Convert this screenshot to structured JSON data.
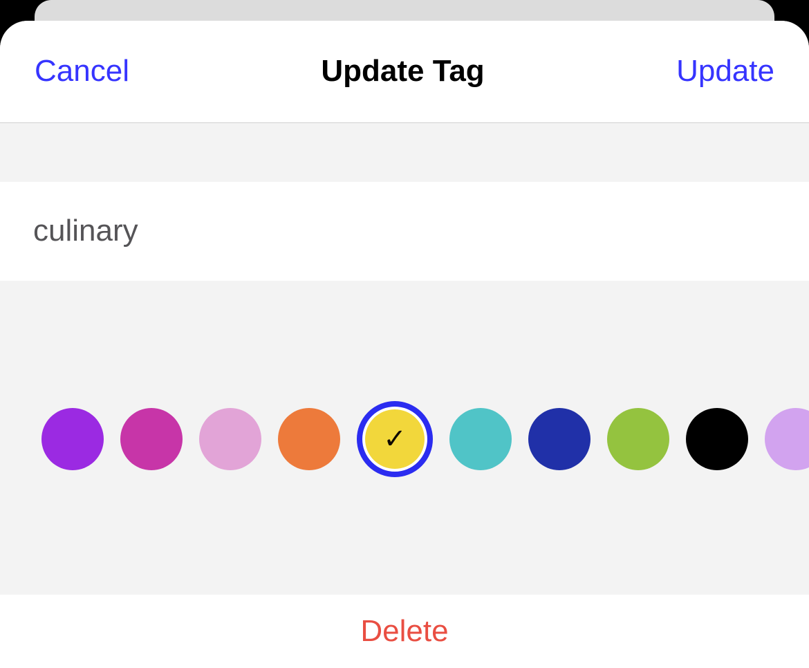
{
  "nav": {
    "cancel": "Cancel",
    "title": "Update Tag",
    "confirm": "Update"
  },
  "tag": {
    "value": "culinary"
  },
  "colors": {
    "selected_index": 4,
    "ring_color": "#2b2cf0",
    "options": [
      {
        "name": "purple",
        "hex": "#9b2ae2"
      },
      {
        "name": "magenta",
        "hex": "#c735a8"
      },
      {
        "name": "pink",
        "hex": "#e2a4d7"
      },
      {
        "name": "orange",
        "hex": "#ed7a3b"
      },
      {
        "name": "yellow",
        "hex": "#f2d73b"
      },
      {
        "name": "teal",
        "hex": "#50c4c7"
      },
      {
        "name": "blue",
        "hex": "#2030a8"
      },
      {
        "name": "green",
        "hex": "#94c33f"
      },
      {
        "name": "black",
        "hex": "#000000"
      },
      {
        "name": "lavender",
        "hex": "#d2a3ef"
      }
    ]
  },
  "actions": {
    "delete": "Delete"
  },
  "icons": {
    "check": "✓"
  }
}
